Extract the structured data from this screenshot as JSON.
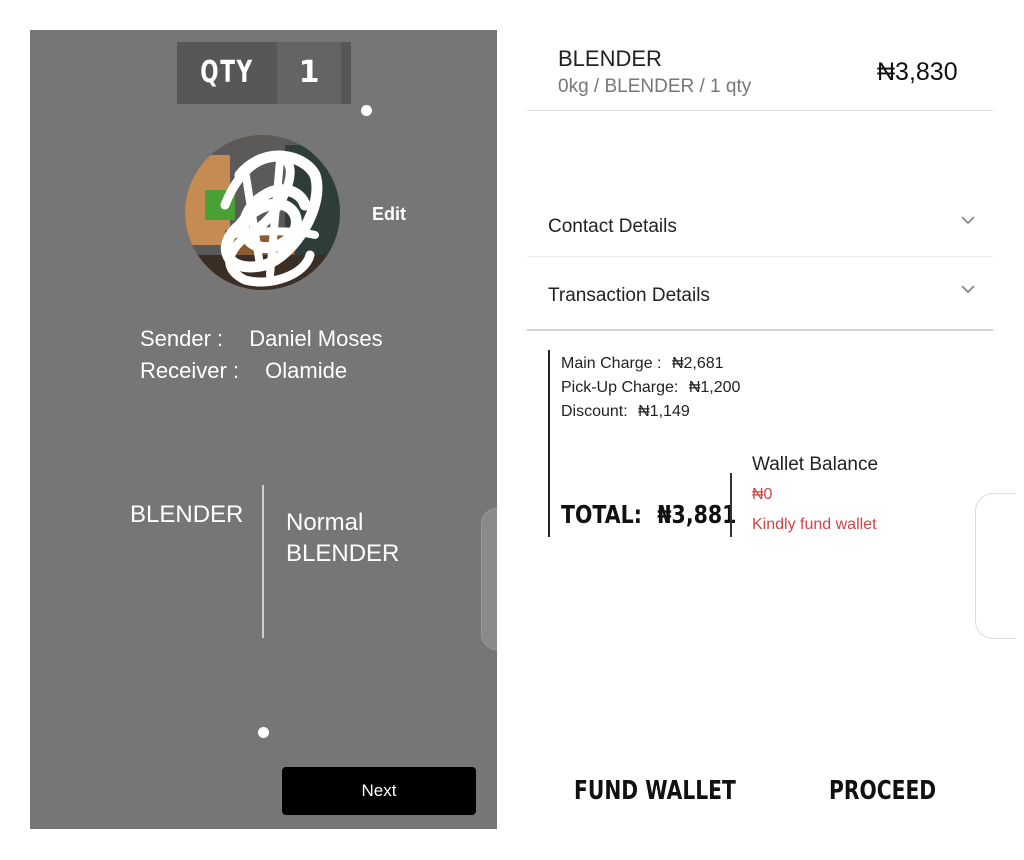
{
  "left": {
    "qty_label": "QTY",
    "qty_value": "1",
    "avatar_icon": "profile-photo-scribbled",
    "edit_label": "Edit",
    "sender_label": "Sender :",
    "sender_value": "Daniel Moses",
    "receiver_label": "Receiver :",
    "receiver_value": "Olamide",
    "item_name": "BLENDER",
    "item_type_line1": "Normal",
    "item_type_line2": "BLENDER",
    "next_label": "Next"
  },
  "right": {
    "order_name": "BLENDER",
    "order_subtitle": "0kg / BLENDER / 1 qty",
    "order_price": "₦3,830",
    "accordions": [
      {
        "label": "Contact Details",
        "icon": "chevron-down-icon"
      },
      {
        "label": "Transaction Details",
        "icon": "chevron-down-icon"
      }
    ],
    "charges": {
      "main_label": "Main Charge :",
      "main_value": "₦2,681",
      "pickup_label": "Pick-Up Charge:",
      "pickup_value": "₦1,200",
      "discount_label": "Discount:",
      "discount_value": "₦1,149"
    },
    "total_label": "TOTAL:",
    "total_value": "₦3,881",
    "wallet_title": "Wallet Balance",
    "wallet_amount": "₦0",
    "wallet_hint": "Kindly fund wallet",
    "fund_wallet_label": "FUND WALLET",
    "proceed_label": "PROCEED"
  },
  "colors": {
    "left_panel_bg": "#777677",
    "alert_red": "#d04545",
    "button_black": "#000000"
  }
}
